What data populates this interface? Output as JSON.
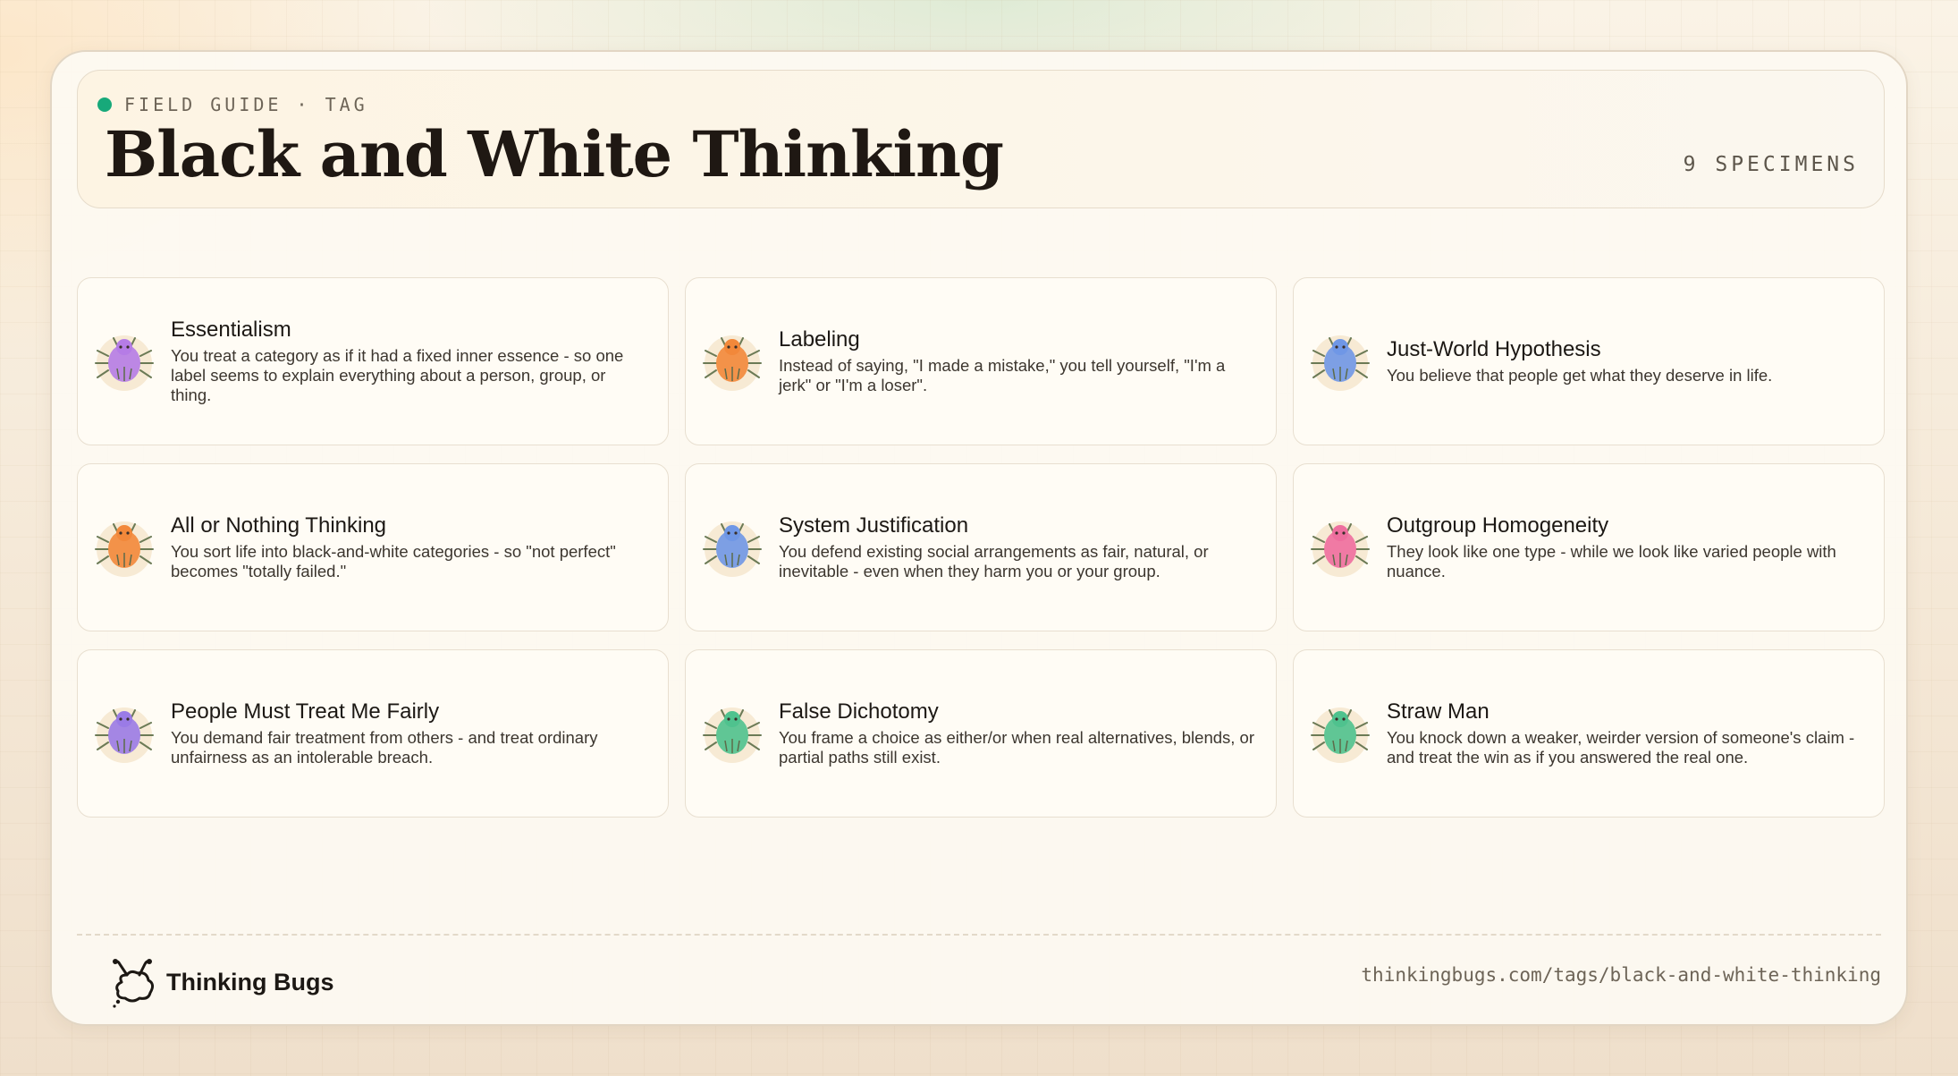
{
  "header": {
    "eyebrow": "FIELD GUIDE · TAG",
    "title": "Black and White Thinking",
    "count": "9 SPECIMENS"
  },
  "cards": [
    {
      "title": "Essentialism",
      "desc": "You treat a category as if it had a fixed inner essence - so one label seems to explain everything about a person, group, or thing.",
      "bug_color": "#b57ce6"
    },
    {
      "title": "Labeling",
      "desc": "Instead of saying, \"I made a mistake,\" you tell yourself, \"I'm a jerk\" or \"I'm a loser\".",
      "bug_color": "#f2883a"
    },
    {
      "title": "Just-World Hypothesis",
      "desc": "You believe that people get what they deserve in life.",
      "bug_color": "#6f97e6"
    },
    {
      "title": "All or Nothing Thinking",
      "desc": "You sort life into black-and-white categories - so \"not perfect\" becomes \"totally failed.\"",
      "bug_color": "#f2883a"
    },
    {
      "title": "System Justification",
      "desc": "You defend existing social arrangements as fair, natural, or inevitable - even when they harm you or your group.",
      "bug_color": "#6f97e6"
    },
    {
      "title": "Outgroup Homogeneity",
      "desc": "They look like one type - while we look like varied people with nuance.",
      "bug_color": "#ee6e9e"
    },
    {
      "title": "People Must Treat Me Fairly",
      "desc": "You demand fair treatment from others - and treat ordinary unfairness as an intolerable breach.",
      "bug_color": "#9a7be6"
    },
    {
      "title": "False Dichotomy",
      "desc": "You frame a choice as either/or when real alternatives, blends, or partial paths still exist.",
      "bug_color": "#4fc28e"
    },
    {
      "title": "Straw Man",
      "desc": "You knock down a weaker, weirder version of someone's claim - and treat the win as if you answered the real one.",
      "bug_color": "#4fc28e"
    }
  ],
  "footer": {
    "brand": "Thinking Bugs",
    "url": "thinkingbugs.com/tags/black-and-white-thinking"
  }
}
